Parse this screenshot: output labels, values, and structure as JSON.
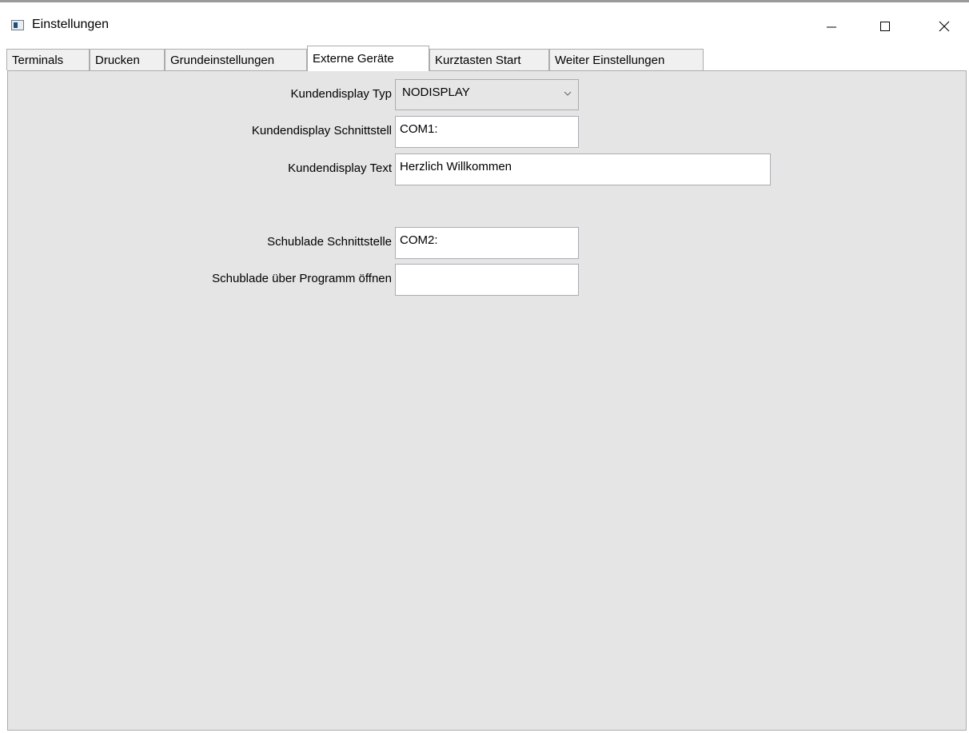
{
  "window": {
    "title": "Einstellungen",
    "icon": "app-window-icon",
    "controls": [
      "minimize-icon",
      "maximize-icon",
      "close-icon"
    ]
  },
  "tabs": [
    {
      "label": "Terminals"
    },
    {
      "label": "Drucken"
    },
    {
      "label": "Grundeinstellungen"
    },
    {
      "label": "Externe Geräte",
      "active": true
    },
    {
      "label": "Kurztasten Start"
    },
    {
      "label": "Weiter Einstellungen"
    }
  ],
  "form": {
    "display_type_label": "Kundendisplay Typ",
    "display_type_value": "NODISPLAY",
    "display_port_label": "Kundendisplay Schnittstell",
    "display_port_value": "COM1:",
    "display_text_label": "Kundendisplay Text",
    "display_text_value": "Herzlich Willkommen",
    "drawer_port_label": "Schublade Schnittstelle",
    "drawer_port_value": "COM2:",
    "drawer_open_label": "Schublade über Programm öffnen",
    "drawer_open_value": ""
  },
  "colors": {
    "panel_background": "#e5e5e5",
    "field_background": "#ffffff",
    "border": "#acacac"
  }
}
